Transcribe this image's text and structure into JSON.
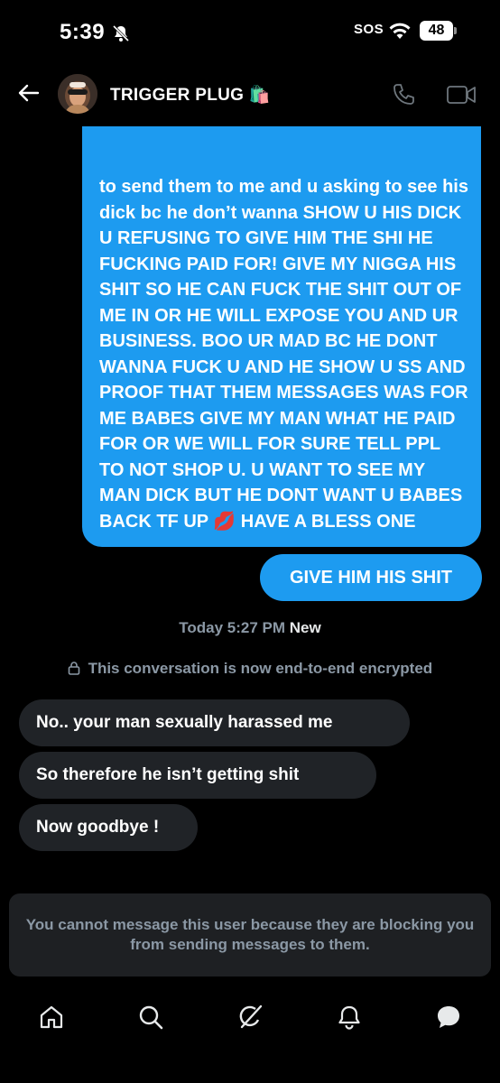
{
  "status_bar": {
    "time": "5:39",
    "sos": "SOS",
    "battery": "48"
  },
  "header": {
    "contact_name": "TRIGGER PLUG 🛍️"
  },
  "messages": {
    "sent_long": "to send them to me and u asking to see his dick bc he don’t wanna SHOW U HIS DICK U REFUSING TO GIVE HIM THE SHI HE FUCKING PAID FOR! GIVE MY NIGGA HIS SHIT SO HE CAN FUCK THE SHIT OUT OF ME IN OR HE WILL EXPOSE YOU AND UR BUSINESS. BOO UR MAD BC HE DONT WANNA FUCK U AND HE SHOW U SS AND PROOF THAT THEM MESSAGES WAS FOR ME BABES GIVE MY MAN WHAT HE PAID FOR OR WE WILL FOR SURE TELL PPL TO NOT SHOP U. U WANT TO SEE MY MAN DICK BUT HE DONT WANT U BABES BACK TF UP 💋 HAVE A BLESS ONE",
    "sent_short": "GIVE HIM HIS SHIT",
    "timestamp": "Today 5:27 PM",
    "timestamp_new": "New",
    "encrypted_notice": "This conversation is now end-to-end encrypted",
    "received": [
      "No.. your man sexually harassed me",
      "So therefore he isn’t getting shit",
      "Now goodbye !"
    ]
  },
  "blocked_notice": "You cannot message this user because they are blocking you from sending messages to them.",
  "colors": {
    "sent_bubble": "#1d9bf0",
    "received_bubble": "#202327",
    "muted_text": "#8b98a5",
    "background": "#000000"
  },
  "nav": [
    "home-icon",
    "search-icon",
    "grok-icon",
    "notifications-icon",
    "messages-icon"
  ]
}
